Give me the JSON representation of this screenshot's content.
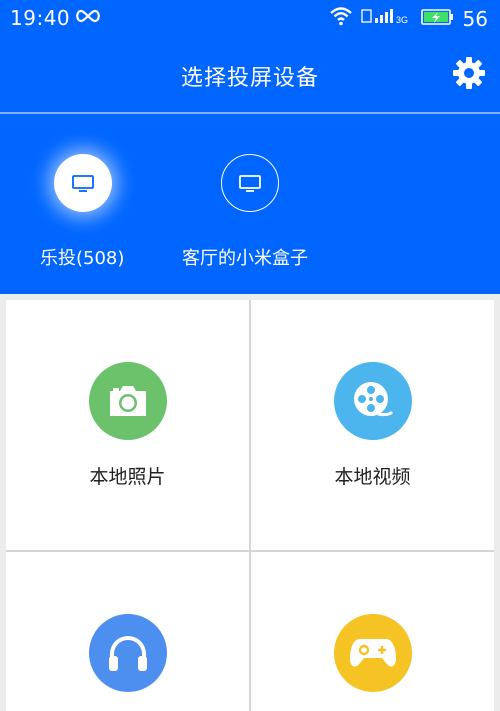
{
  "status_bar": {
    "time": "19:40",
    "network": "3G",
    "battery_level": "56"
  },
  "header": {
    "title": "选择投屏设备",
    "settings_icon": "gear-icon"
  },
  "devices": [
    {
      "label": "乐投(508)",
      "icon": "tv-icon",
      "selected": true
    },
    {
      "label": "客厅的小米盒子",
      "icon": "tv-icon",
      "selected": false
    }
  ],
  "tiles": [
    {
      "label": "本地照片",
      "icon": "camera-icon",
      "color": "#6cc26b"
    },
    {
      "label": "本地视频",
      "icon": "film-reel-icon",
      "color": "#4cb5ee"
    },
    {
      "label": "",
      "icon": "headphones-icon",
      "color": "#4c8fee"
    },
    {
      "label": "",
      "icon": "gamepad-icon",
      "color": "#f5c323"
    }
  ],
  "colors": {
    "brand_blue": "#0066ff",
    "background": "#ececec"
  }
}
